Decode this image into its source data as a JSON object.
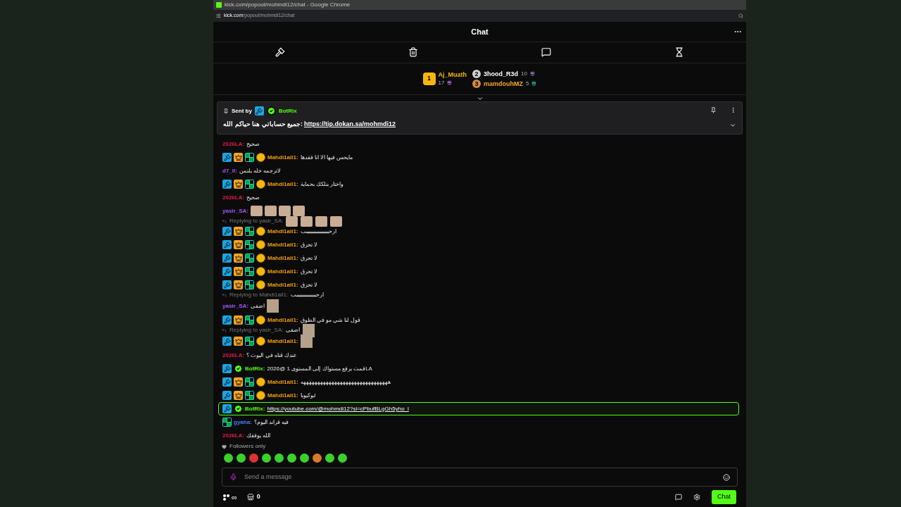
{
  "window": {
    "title": "kick.com/popout/mohmdi12/chat - Google Chrome",
    "url_host": "kick.com",
    "url_path": "/popout/mohmdi12/chat"
  },
  "header": {
    "title": "Chat"
  },
  "toolbar": [
    {
      "kind": "gavel"
    },
    {
      "kind": "trash"
    },
    {
      "kind": "chat"
    },
    {
      "kind": "hourglass"
    }
  ],
  "leaderboard": {
    "top": {
      "rank": "1",
      "name": "Aj_Muath",
      "count": "17"
    },
    "runners_up": [
      {
        "rank": "2",
        "name": "3hood_R3d",
        "count": "10"
      },
      {
        "rank": "3",
        "name": "mamdouhMZ",
        "count": "5"
      }
    ]
  },
  "pinned": {
    "sent_by": "Sent by",
    "name": "BotRix",
    "text": "جميع حساباتي هنا حياكم الله:",
    "link": "https://tip.dokan.sa/mohmdi12"
  },
  "messages": [
    {
      "user": "2026LA:",
      "color": "#e11d48",
      "highlighted": false,
      "parts": [
        {
          "kind": "text",
          "text": "صحيح"
        }
      ]
    },
    {
      "user": "Mahdi1ali1:",
      "color": "#f59e0b",
      "highlighted": false,
      "badges": [
        {
          "kind": "mod"
        },
        {
          "kind": "crown"
        },
        {
          "kind": "og"
        },
        {
          "kind": "gift"
        }
      ],
      "parts": [
        {
          "kind": "text",
          "text": "مايحس فيها الا انا فقدها"
        }
      ]
    },
    {
      "user": "d7_ll:",
      "color": "#a855f7",
      "highlighted": false,
      "parts": [
        {
          "kind": "text",
          "text": "لاترجمه خله يلتمن"
        }
      ]
    },
    {
      "user": "Mahdi1ali1:",
      "color": "#f59e0b",
      "highlighted": false,
      "badges": [
        {
          "kind": "mod"
        },
        {
          "kind": "crown"
        },
        {
          "kind": "og"
        },
        {
          "kind": "gift"
        }
      ],
      "parts": [
        {
          "kind": "text",
          "text": "واختار بنلكك بحماية"
        }
      ]
    },
    {
      "user": "2026LA:",
      "color": "#e11d48",
      "highlighted": false,
      "parts": [
        {
          "kind": "text",
          "text": "صحيح"
        }
      ]
    },
    {
      "user": "yasir_SA:",
      "color": "#a855f7",
      "highlighted": false,
      "parts": [
        {
          "kind": "emote"
        },
        {
          "kind": "emote"
        },
        {
          "kind": "emote"
        },
        {
          "kind": "emote"
        }
      ]
    },
    {
      "reply": {
        "label": "Replying to yasir_SA:",
        "parts": [
          {
            "kind": "emote"
          },
          {
            "kind": "emote"
          },
          {
            "kind": "emote"
          },
          {
            "kind": "emote"
          }
        ]
      },
      "user": "Mahdi1ali1:",
      "color": "#f59e0b",
      "highlighted": false,
      "badges": [
        {
          "kind": "mod"
        },
        {
          "kind": "crown"
        },
        {
          "kind": "og"
        },
        {
          "kind": "gift"
        }
      ],
      "parts": [
        {
          "kind": "text",
          "text": "ارحببببببببببببببببب"
        }
      ]
    },
    {
      "user": "Mahdi1ali1:",
      "color": "#f59e0b",
      "highlighted": false,
      "badges": [
        {
          "kind": "mod"
        },
        {
          "kind": "crown"
        },
        {
          "kind": "og"
        },
        {
          "kind": "gift"
        }
      ],
      "parts": [
        {
          "kind": "text",
          "text": "لا تحرق"
        }
      ]
    },
    {
      "user": "Mahdi1ali1:",
      "color": "#f59e0b",
      "highlighted": false,
      "badges": [
        {
          "kind": "mod"
        },
        {
          "kind": "crown"
        },
        {
          "kind": "og"
        },
        {
          "kind": "gift"
        }
      ],
      "parts": [
        {
          "kind": "text",
          "text": "لا تحرق"
        }
      ]
    },
    {
      "user": "Mahdi1ali1:",
      "color": "#f59e0b",
      "highlighted": false,
      "badges": [
        {
          "kind": "mod"
        },
        {
          "kind": "crown"
        },
        {
          "kind": "og"
        },
        {
          "kind": "gift"
        }
      ],
      "parts": [
        {
          "kind": "text",
          "text": "لا تحرق"
        }
      ]
    },
    {
      "user": "Mahdi1ali1:",
      "color": "#f59e0b",
      "highlighted": false,
      "badges": [
        {
          "kind": "mod"
        },
        {
          "kind": "crown"
        },
        {
          "kind": "og"
        },
        {
          "kind": "gift"
        }
      ],
      "parts": [
        {
          "kind": "text",
          "text": "لا تحرق"
        }
      ]
    },
    {
      "reply": {
        "label": "Replying to Mahdi1ali1:",
        "parts": [
          {
            "kind": "text",
            "text": "ارحببببببببببببببب"
          }
        ]
      },
      "user": "yasir_SA:",
      "color": "#a855f7",
      "highlighted": false,
      "parts": [
        {
          "kind": "text",
          "text": "اضفى"
        },
        {
          "kind": "photo"
        }
      ]
    },
    {
      "user": "Mahdi1ali1:",
      "color": "#f59e0b",
      "highlighted": false,
      "badges": [
        {
          "kind": "mod"
        },
        {
          "kind": "crown"
        },
        {
          "kind": "og"
        },
        {
          "kind": "gift"
        }
      ],
      "parts": [
        {
          "kind": "text",
          "text": "قول لنا شي مو في الطوق"
        }
      ]
    },
    {
      "reply": {
        "label": "Replying to yasir_SA:",
        "parts": [
          {
            "kind": "text",
            "text": "اضفى"
          },
          {
            "kind": "photo"
          }
        ]
      },
      "user": "Mahdi1ali1:",
      "color": "#f59e0b",
      "highlighted": false,
      "badges": [
        {
          "kind": "mod"
        },
        {
          "kind": "crown"
        },
        {
          "kind": "og"
        },
        {
          "kind": "gift"
        }
      ],
      "parts": [
        {
          "kind": "photo"
        }
      ]
    },
    {
      "user": "2026LA:",
      "color": "#e11d48",
      "highlighted": false,
      "parts": [
        {
          "kind": "text",
          "text": "عندك قناه في اليوت ؟"
        }
      ]
    },
    {
      "user": "BotRix:",
      "color": "#53fc18",
      "highlighted": false,
      "badges": [
        {
          "kind": "mod"
        },
        {
          "kind": "verified"
        }
      ],
      "parts": [
        {
          "kind": "text",
          "text": "قمت برفع مستواك إلى المستوى 1 @2026LA"
        }
      ]
    },
    {
      "user": "Mahdi1ali1:",
      "color": "#f59e0b",
      "highlighted": false,
      "badges": [
        {
          "kind": "mod"
        },
        {
          "kind": "crown"
        },
        {
          "kind": "og"
        },
        {
          "kind": "gift"
        }
      ],
      "parts": [
        {
          "kind": "text",
          "text": "هههههههههههههههههههههههههههههههه"
        }
      ]
    },
    {
      "user": "Mahdi1ali1:",
      "color": "#f59e0b",
      "highlighted": false,
      "badges": [
        {
          "kind": "mod"
        },
        {
          "kind": "crown"
        },
        {
          "kind": "og"
        },
        {
          "kind": "gift"
        }
      ],
      "parts": [
        {
          "kind": "text",
          "text": "بوكيوبا!"
        }
      ]
    },
    {
      "user": "BotRix:",
      "color": "#53fc18",
      "highlighted": true,
      "badges": [
        {
          "kind": "mod"
        },
        {
          "kind": "verified"
        }
      ],
      "parts": [
        {
          "kind": "link",
          "text": "https://youtube.com/@mohmdi12?si=cPbufBLgGh5yho_l"
        }
      ]
    },
    {
      "user": "gyaha:",
      "color": "#3b82f6",
      "highlighted": false,
      "badges": [
        {
          "kind": "og"
        }
      ],
      "parts": [
        {
          "kind": "text",
          "text": "فيه قراند اليوم؟"
        }
      ]
    },
    {
      "user": "2026LA:",
      "color": "#e11d48",
      "highlighted": false,
      "parts": [
        {
          "kind": "text",
          "text": "الله يوفقك"
        }
      ]
    }
  ],
  "chat_mode": "Followers only",
  "input": {
    "placeholder": "Send a message"
  },
  "footer": {
    "points": "∞",
    "store_count": "0",
    "chat_button": "Chat"
  }
}
